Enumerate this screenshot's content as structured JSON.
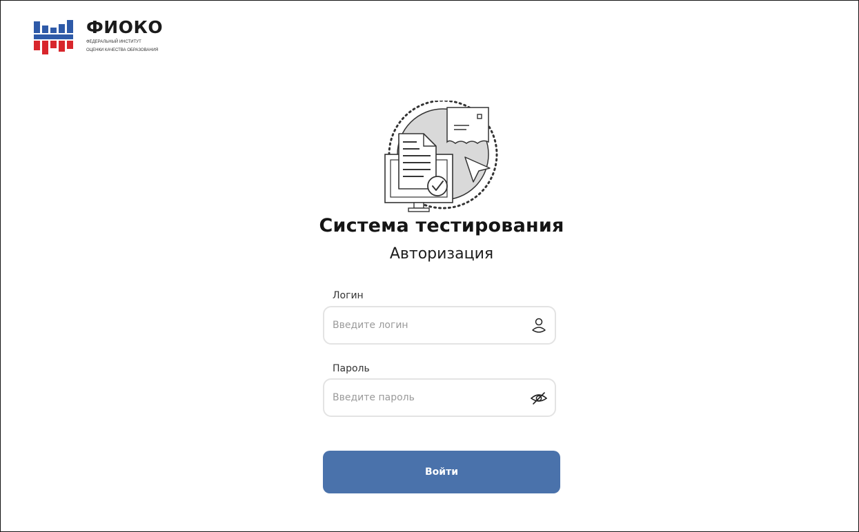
{
  "logo": {
    "name": "ФИОКО",
    "subtitle_line1": "ФЕДЕРАЛЬНЫЙ ИНСТИТУТ",
    "subtitle_line2": "ОЦЕНКИ КАЧЕСТВА ОБРАЗОВАНИЯ",
    "colors": {
      "blue": "#2e5aa8",
      "red": "#d8262c",
      "white": "#ffffff"
    }
  },
  "header": {
    "title": "Система тестирования",
    "subtitle": "Авторизация"
  },
  "form": {
    "login": {
      "label": "Логин",
      "placeholder": "Введите логин",
      "value": "",
      "icon": "user-icon"
    },
    "password": {
      "label": "Пароль",
      "placeholder": "Введите пароль",
      "value": "",
      "icon": "eye-off-icon"
    },
    "submit_label": "Войти"
  },
  "colors": {
    "accent": "#4a72ab",
    "input_border": "#e3e3e3",
    "placeholder": "#9a9a9a"
  },
  "illustration": {
    "icon": "testing-system-illustration"
  }
}
